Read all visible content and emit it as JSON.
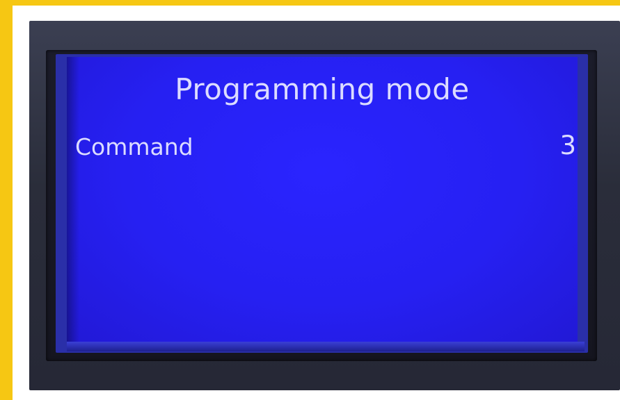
{
  "screen": {
    "title": "Programming mode",
    "rows": [
      {
        "label": "Command",
        "value": "3"
      }
    ]
  },
  "colors": {
    "display_background": "#2620f2",
    "display_text": "#dcdcff",
    "bezel": "#2a2d3a",
    "outer_frame": "#f6c713"
  }
}
